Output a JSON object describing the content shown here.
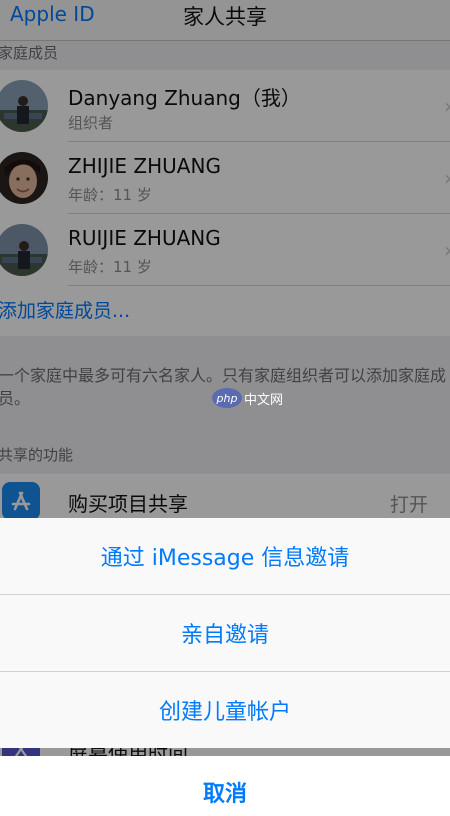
{
  "nav": {
    "back_label": "Apple ID",
    "title": "家人共享"
  },
  "members_section": {
    "header": "家庭成员",
    "members": [
      {
        "name": "Danyang Zhuang（我）",
        "subtitle": "组织者"
      },
      {
        "name": "ZHIJIE ZHUANG",
        "subtitle": "年龄：11 岁"
      },
      {
        "name": "RUIJIE ZHUANG",
        "subtitle": "年龄：11 岁"
      }
    ],
    "add_member_label": "添加家庭成员...",
    "footer": "一个家庭中最多可有六名家人。只有家庭组织者可以添加家庭成员。"
  },
  "features_section": {
    "header": "共享的功能",
    "purchase_sharing": {
      "label": "购买项目共享",
      "value": "打开"
    },
    "screen_time": {
      "label": "屏幕使用时间"
    }
  },
  "action_sheet": {
    "imessage_invite": "通过 iMessage 信息邀请",
    "in_person_invite": "亲自邀请",
    "create_child_account": "创建儿童帐户",
    "cancel": "取消"
  },
  "watermark": {
    "logo_text": "php",
    "site_text": "中文网"
  },
  "colors": {
    "accent": "#007aff",
    "background": "#efeff4",
    "dim_overlay": "rgba(0,0,0,0.40)"
  }
}
